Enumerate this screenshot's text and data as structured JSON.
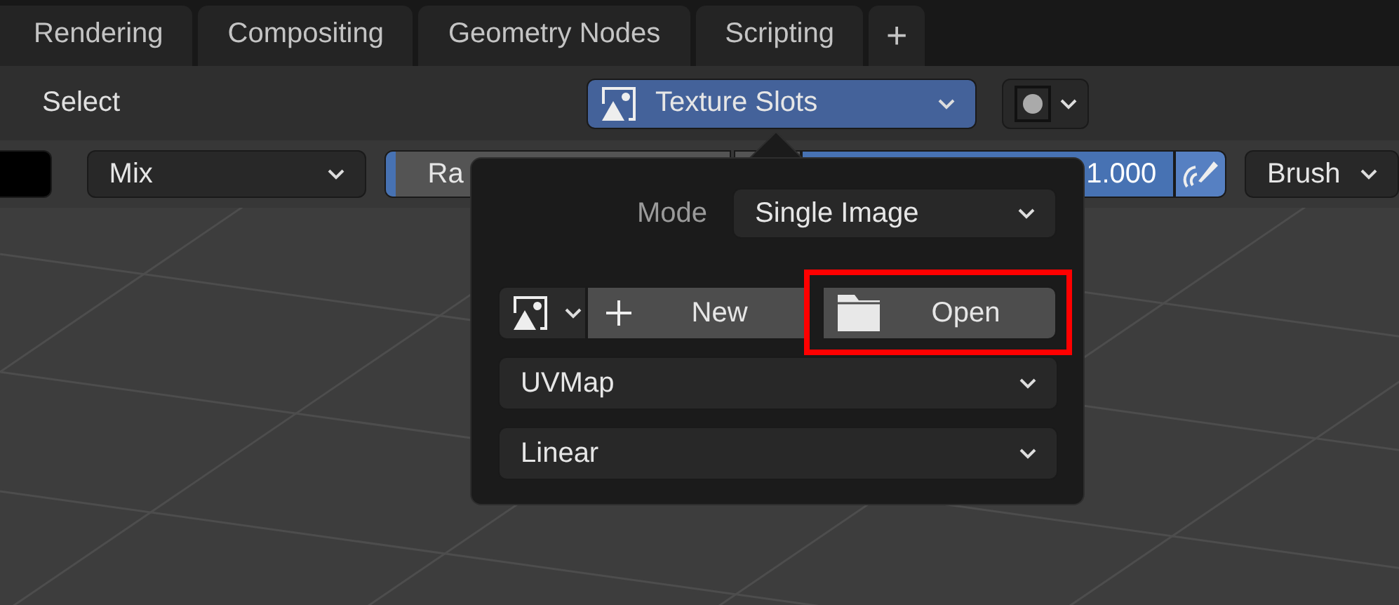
{
  "workspace_tabs": [
    {
      "label": "Rendering",
      "selected": false
    },
    {
      "label": "Compositing",
      "selected": false
    },
    {
      "label": "Geometry Nodes",
      "selected": false
    },
    {
      "label": "Scripting",
      "selected": false
    }
  ],
  "add_tab_button": "+",
  "header": {
    "menu": "Select",
    "texture_slots": "Texture Slots"
  },
  "tool_settings": {
    "color_swatch": {
      "color": "#000000"
    },
    "blend_mode": "Mix",
    "radius": {
      "label": "Ra",
      "level": 0.03
    },
    "strength": {
      "value": "1.000",
      "level": 1
    },
    "brush": "Brush"
  },
  "popup": {
    "mode_label": "Mode",
    "mode_value": "Single Image",
    "new_button": "New",
    "open_button": {
      "label": "Open",
      "highlighted": true
    },
    "uv_map": "UVMap",
    "interpolation": "Linear"
  }
}
